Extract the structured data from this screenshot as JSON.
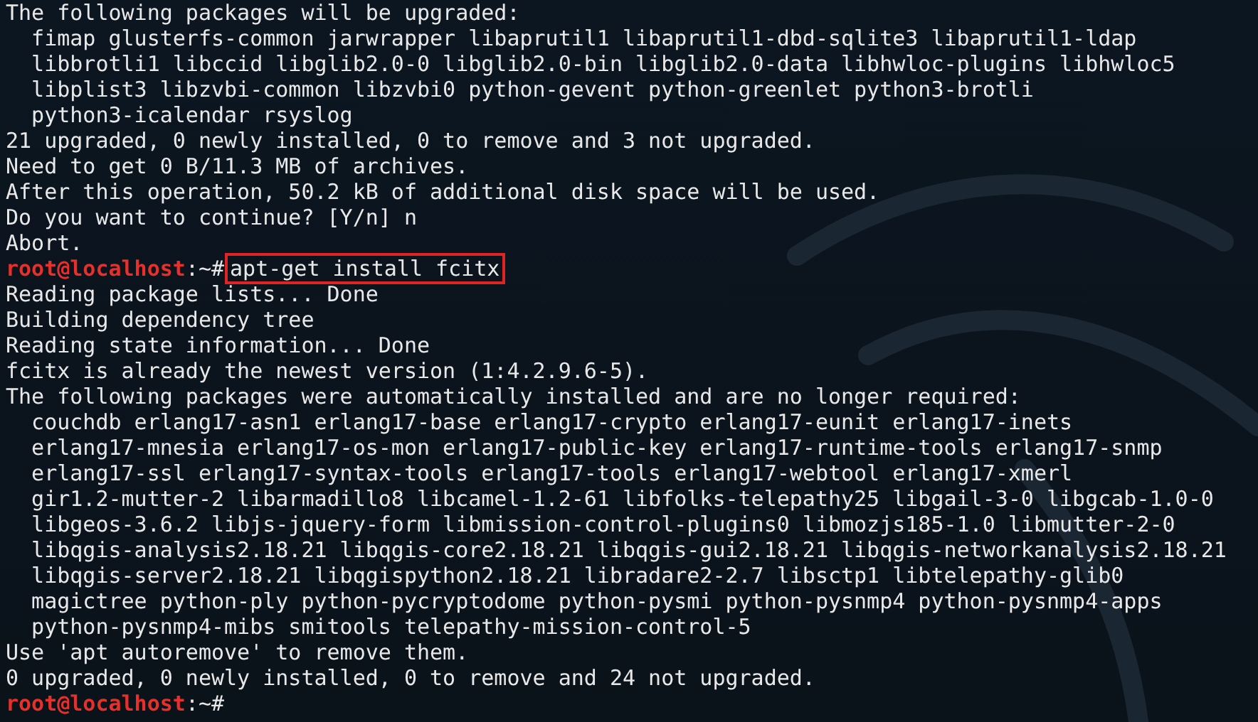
{
  "terminal": {
    "lines": [
      {
        "kind": "output",
        "text": "The following packages will be upgraded:"
      },
      {
        "kind": "output",
        "text": "  fimap glusterfs-common jarwrapper libaprutil1 libaprutil1-dbd-sqlite3 libaprutil1-ldap"
      },
      {
        "kind": "output",
        "text": "  libbrotli1 libccid libglib2.0-0 libglib2.0-bin libglib2.0-data libhwloc-plugins libhwloc5"
      },
      {
        "kind": "output",
        "text": "  libplist3 libzvbi-common libzvbi0 python-gevent python-greenlet python3-brotli"
      },
      {
        "kind": "output",
        "text": "  python3-icalendar rsyslog"
      },
      {
        "kind": "output",
        "text": "21 upgraded, 0 newly installed, 0 to remove and 3 not upgraded."
      },
      {
        "kind": "output",
        "text": "Need to get 0 B/11.3 MB of archives."
      },
      {
        "kind": "output",
        "text": "After this operation, 50.2 kB of additional disk space will be used."
      },
      {
        "kind": "output",
        "text": "Do you want to continue? [Y/n] n"
      },
      {
        "kind": "output",
        "text": "Abort."
      },
      {
        "kind": "prompt",
        "user": "root@localhost",
        "path": ":~#",
        "command": "apt-get install fcitx",
        "highlighted": true
      },
      {
        "kind": "output",
        "text": "Reading package lists... Done"
      },
      {
        "kind": "output",
        "text": "Building dependency tree"
      },
      {
        "kind": "output",
        "text": "Reading state information... Done"
      },
      {
        "kind": "output",
        "text": "fcitx is already the newest version (1:4.2.9.6-5)."
      },
      {
        "kind": "output",
        "text": "The following packages were automatically installed and are no longer required:"
      },
      {
        "kind": "output",
        "text": "  couchdb erlang17-asn1 erlang17-base erlang17-crypto erlang17-eunit erlang17-inets"
      },
      {
        "kind": "output",
        "text": "  erlang17-mnesia erlang17-os-mon erlang17-public-key erlang17-runtime-tools erlang17-snmp"
      },
      {
        "kind": "output",
        "text": "  erlang17-ssl erlang17-syntax-tools erlang17-tools erlang17-webtool erlang17-xmerl"
      },
      {
        "kind": "output",
        "text": "  gir1.2-mutter-2 libarmadillo8 libcamel-1.2-61 libfolks-telepathy25 libgail-3-0 libgcab-1.0-0"
      },
      {
        "kind": "output",
        "text": "  libgeos-3.6.2 libjs-jquery-form libmission-control-plugins0 libmozjs185-1.0 libmutter-2-0"
      },
      {
        "kind": "output",
        "text": "  libqgis-analysis2.18.21 libqgis-core2.18.21 libqgis-gui2.18.21 libqgis-networkanalysis2.18.21"
      },
      {
        "kind": "output",
        "text": "  libqgis-server2.18.21 libqgispython2.18.21 libradare2-2.7 libsctp1 libtelepathy-glib0"
      },
      {
        "kind": "output",
        "text": "  magictree python-ply python-pycryptodome python-pysmi python-pysnmp4 python-pysnmp4-apps"
      },
      {
        "kind": "output",
        "text": "  python-pysnmp4-mibs smitools telepathy-mission-control-5"
      },
      {
        "kind": "output",
        "text": "Use 'apt autoremove' to remove them."
      },
      {
        "kind": "output",
        "text": "0 upgraded, 0 newly installed, 0 to remove and 24 not upgraded."
      },
      {
        "kind": "prompt",
        "user": "root@localhost",
        "path": ":~#"
      }
    ]
  }
}
